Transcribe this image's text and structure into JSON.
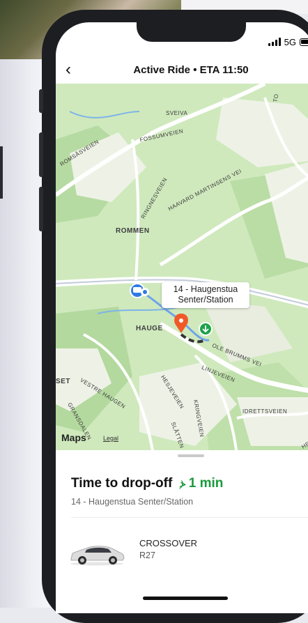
{
  "status_bar": {
    "network": "5G"
  },
  "nav": {
    "back_icon": "chevron-left-icon",
    "title": "Active Ride • ETA 11:50"
  },
  "map": {
    "street_labels": {
      "sveiva": "SVEIVA",
      "fossumveien": "FOSSUMVEIEN",
      "romsasveien": "ROMSÅSVEIEN",
      "ringnesveien": "RINGNESVEIEN",
      "haavard": "HAAVARD MARTINSENS VEI",
      "vestre_haugen": "VESTRE HAUGEN",
      "gransdalen": "GRANSDALEN",
      "hesjeveien": "HESJEVEIEN",
      "linjeveien": "LINJEVEIEN",
      "ole_brumms": "OLE BRUMMS VEI",
      "kringveien": "KRINGVEIEN",
      "idrettsveien": "IDRETTSVEIEN",
      "slatten": "SLÅTTEN",
      "set": "SET",
      "to": "TO",
      "heim": "HEIM"
    },
    "place_labels": {
      "rommen": "ROMMEN",
      "hauge": "HAUGE"
    },
    "stop_callout": {
      "line1": "14 - Haugenstua",
      "line2": "Senter/Station"
    },
    "attribution": {
      "logo": "Maps",
      "legal": "Legal"
    },
    "icons": {
      "car_marker": "taxi-icon",
      "pickup_pin": "location-pin-icon",
      "dropoff_marker": "arrow-down-icon"
    },
    "colors": {
      "route": "#333333",
      "pin": "#f05a28",
      "dropoff": "#1aa34a",
      "car": "#2f7be5"
    }
  },
  "sheet": {
    "title": "Time to drop-off",
    "eta_icon": "signal-icon",
    "eta": "1 min",
    "destination": "14 - Haugenstua Senter/Station",
    "car_model": "CROSSOVER",
    "car_plate": "R27",
    "accent": "#1a9a3c"
  }
}
